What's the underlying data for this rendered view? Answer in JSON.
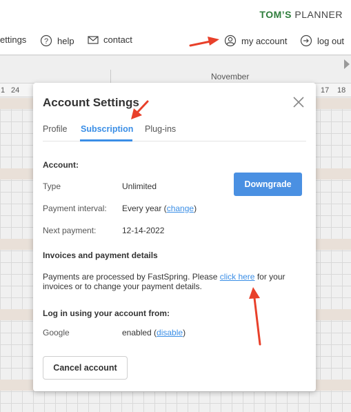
{
  "brand": {
    "part1": "TOM’S",
    "part2": "PLANNER"
  },
  "nav": {
    "settings": "ettings",
    "help": "help",
    "contact": "contact",
    "my_account": "my account",
    "logout": "log out"
  },
  "planner": {
    "month": "November",
    "days": [
      "1",
      "24",
      "17",
      "18"
    ]
  },
  "modal": {
    "title": "Account Settings",
    "tabs": [
      "Profile",
      "Subscription",
      "Plug-ins"
    ],
    "active_tab": "Subscription",
    "account_heading": "Account:",
    "type_label": "Type",
    "type_value": "Unlimited",
    "interval_label": "Payment interval:",
    "interval_value": "Every year (",
    "interval_link": "change",
    "interval_close": ")",
    "next_label": "Next payment:",
    "next_value": "12-14-2022",
    "downgrade_label": "Downgrade",
    "invoices_heading": "Invoices and payment details",
    "invoices_text_1": "Payments are processed by FastSpring. Please ",
    "invoices_link": "click here",
    "invoices_text_2": " for your invoices or to change your payment details.",
    "login_heading": "Log in using your account from:",
    "google_label": "Google",
    "google_value": "enabled (",
    "google_link": "disable",
    "google_close": ")",
    "cancel_label": "Cancel account"
  },
  "colors": {
    "accent": "#3a8ee6",
    "button": "#4a90e2",
    "brand_green": "#2e7d3b",
    "annotation": "#e8402a"
  },
  "icons": [
    "help-icon",
    "contact-icon",
    "account-icon",
    "logout-icon",
    "close-icon",
    "chevron-right-icon"
  ]
}
